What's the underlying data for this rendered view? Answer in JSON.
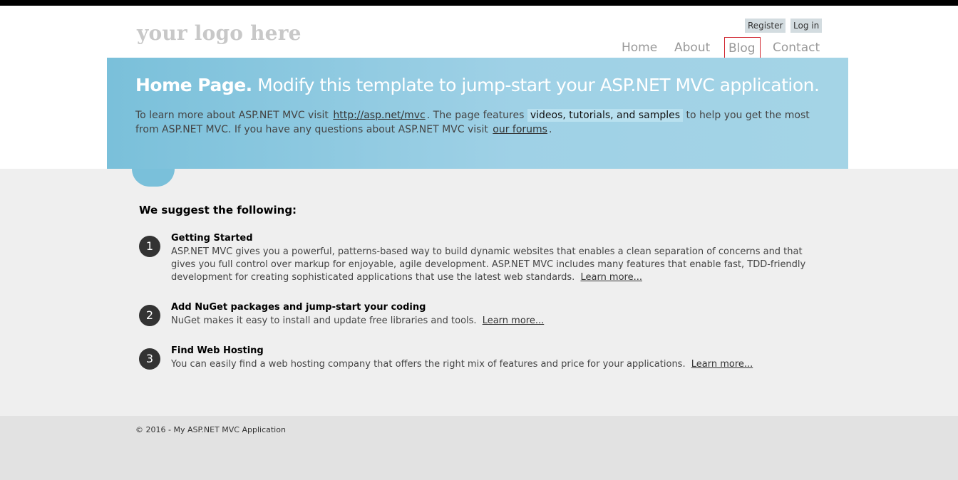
{
  "header": {
    "logo": "your logo here",
    "register": "Register",
    "login": "Log in"
  },
  "nav": {
    "items": [
      "Home",
      "About",
      "Blog",
      "Contact"
    ],
    "active_border_color": "#d0242e"
  },
  "featured": {
    "title": "Home Page.",
    "subtitle": "Modify this template to jump-start your ASP.NET MVC application.",
    "text_1": "To learn more about ASP.NET MVC visit",
    "link_1": "http://asp.net/mvc",
    "text_2": ". The page features",
    "highlight": "videos, tutorials, and samples",
    "text_3": "to help you get the most from ASP.NET MVC. If you have any questions about ASP.NET MVC visit",
    "link_2": "our forums",
    "text_4": ".",
    "color": "#7ac0da"
  },
  "main": {
    "heading": "We suggest the following:",
    "steps": [
      {
        "number": "1",
        "title": "Getting Started",
        "text": "ASP.NET MVC gives you a powerful, patterns-based way to build dynamic websites that enables a clean separation of concerns and that gives you full control over markup for enjoyable, agile development. ASP.NET MVC includes many features that enable fast, TDD-friendly development for creating sophisticated applications that use the latest web standards.",
        "link": "Learn more..."
      },
      {
        "number": "2",
        "title": "Add NuGet packages and jump-start your coding",
        "text": "NuGet makes it easy to install and update free libraries and tools.",
        "link": "Learn more..."
      },
      {
        "number": "3",
        "title": "Find Web Hosting",
        "text": "You can easily find a web hosting company that offers the right mix of features and price for your applications.",
        "link": "Learn more..."
      }
    ]
  },
  "footer": {
    "copyright": "© 2016 - My ASP.NET MVC Application"
  }
}
